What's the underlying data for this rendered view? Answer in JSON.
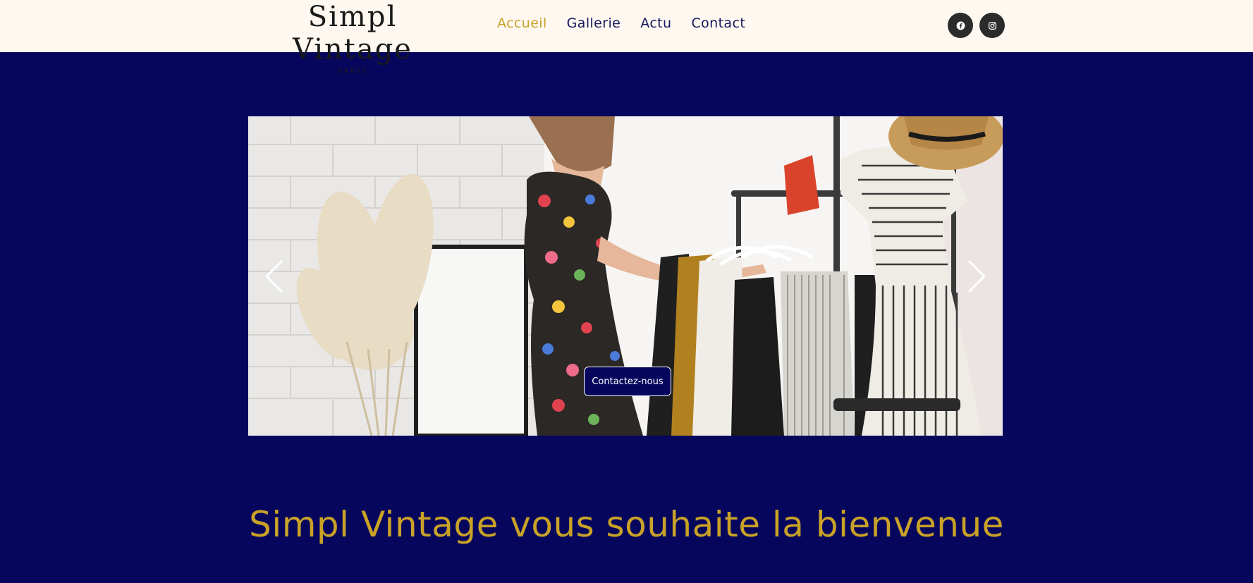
{
  "brand": {
    "name": "Simpl Vintage",
    "tagline": "PARIS"
  },
  "nav": {
    "items": [
      {
        "label": "Accueil",
        "active": true
      },
      {
        "label": "Gallerie",
        "active": false
      },
      {
        "label": "Actu",
        "active": false
      },
      {
        "label": "Contact",
        "active": false
      }
    ]
  },
  "social": {
    "items": [
      {
        "icon": "facebook-icon"
      },
      {
        "icon": "instagram-icon"
      }
    ]
  },
  "hero": {
    "cta_label": "Contactez-nous",
    "prev_icon": "chevron-left-icon",
    "next_icon": "chevron-right-icon"
  },
  "welcome": {
    "title": "Simpl Vintage vous souhaite la bienvenue"
  },
  "colors": {
    "page_background": "#06065d",
    "header_background": "#fff8f0",
    "accent_gold": "#c9a227",
    "nav_text": "#16165e",
    "social_button": "#2b2b2b"
  }
}
